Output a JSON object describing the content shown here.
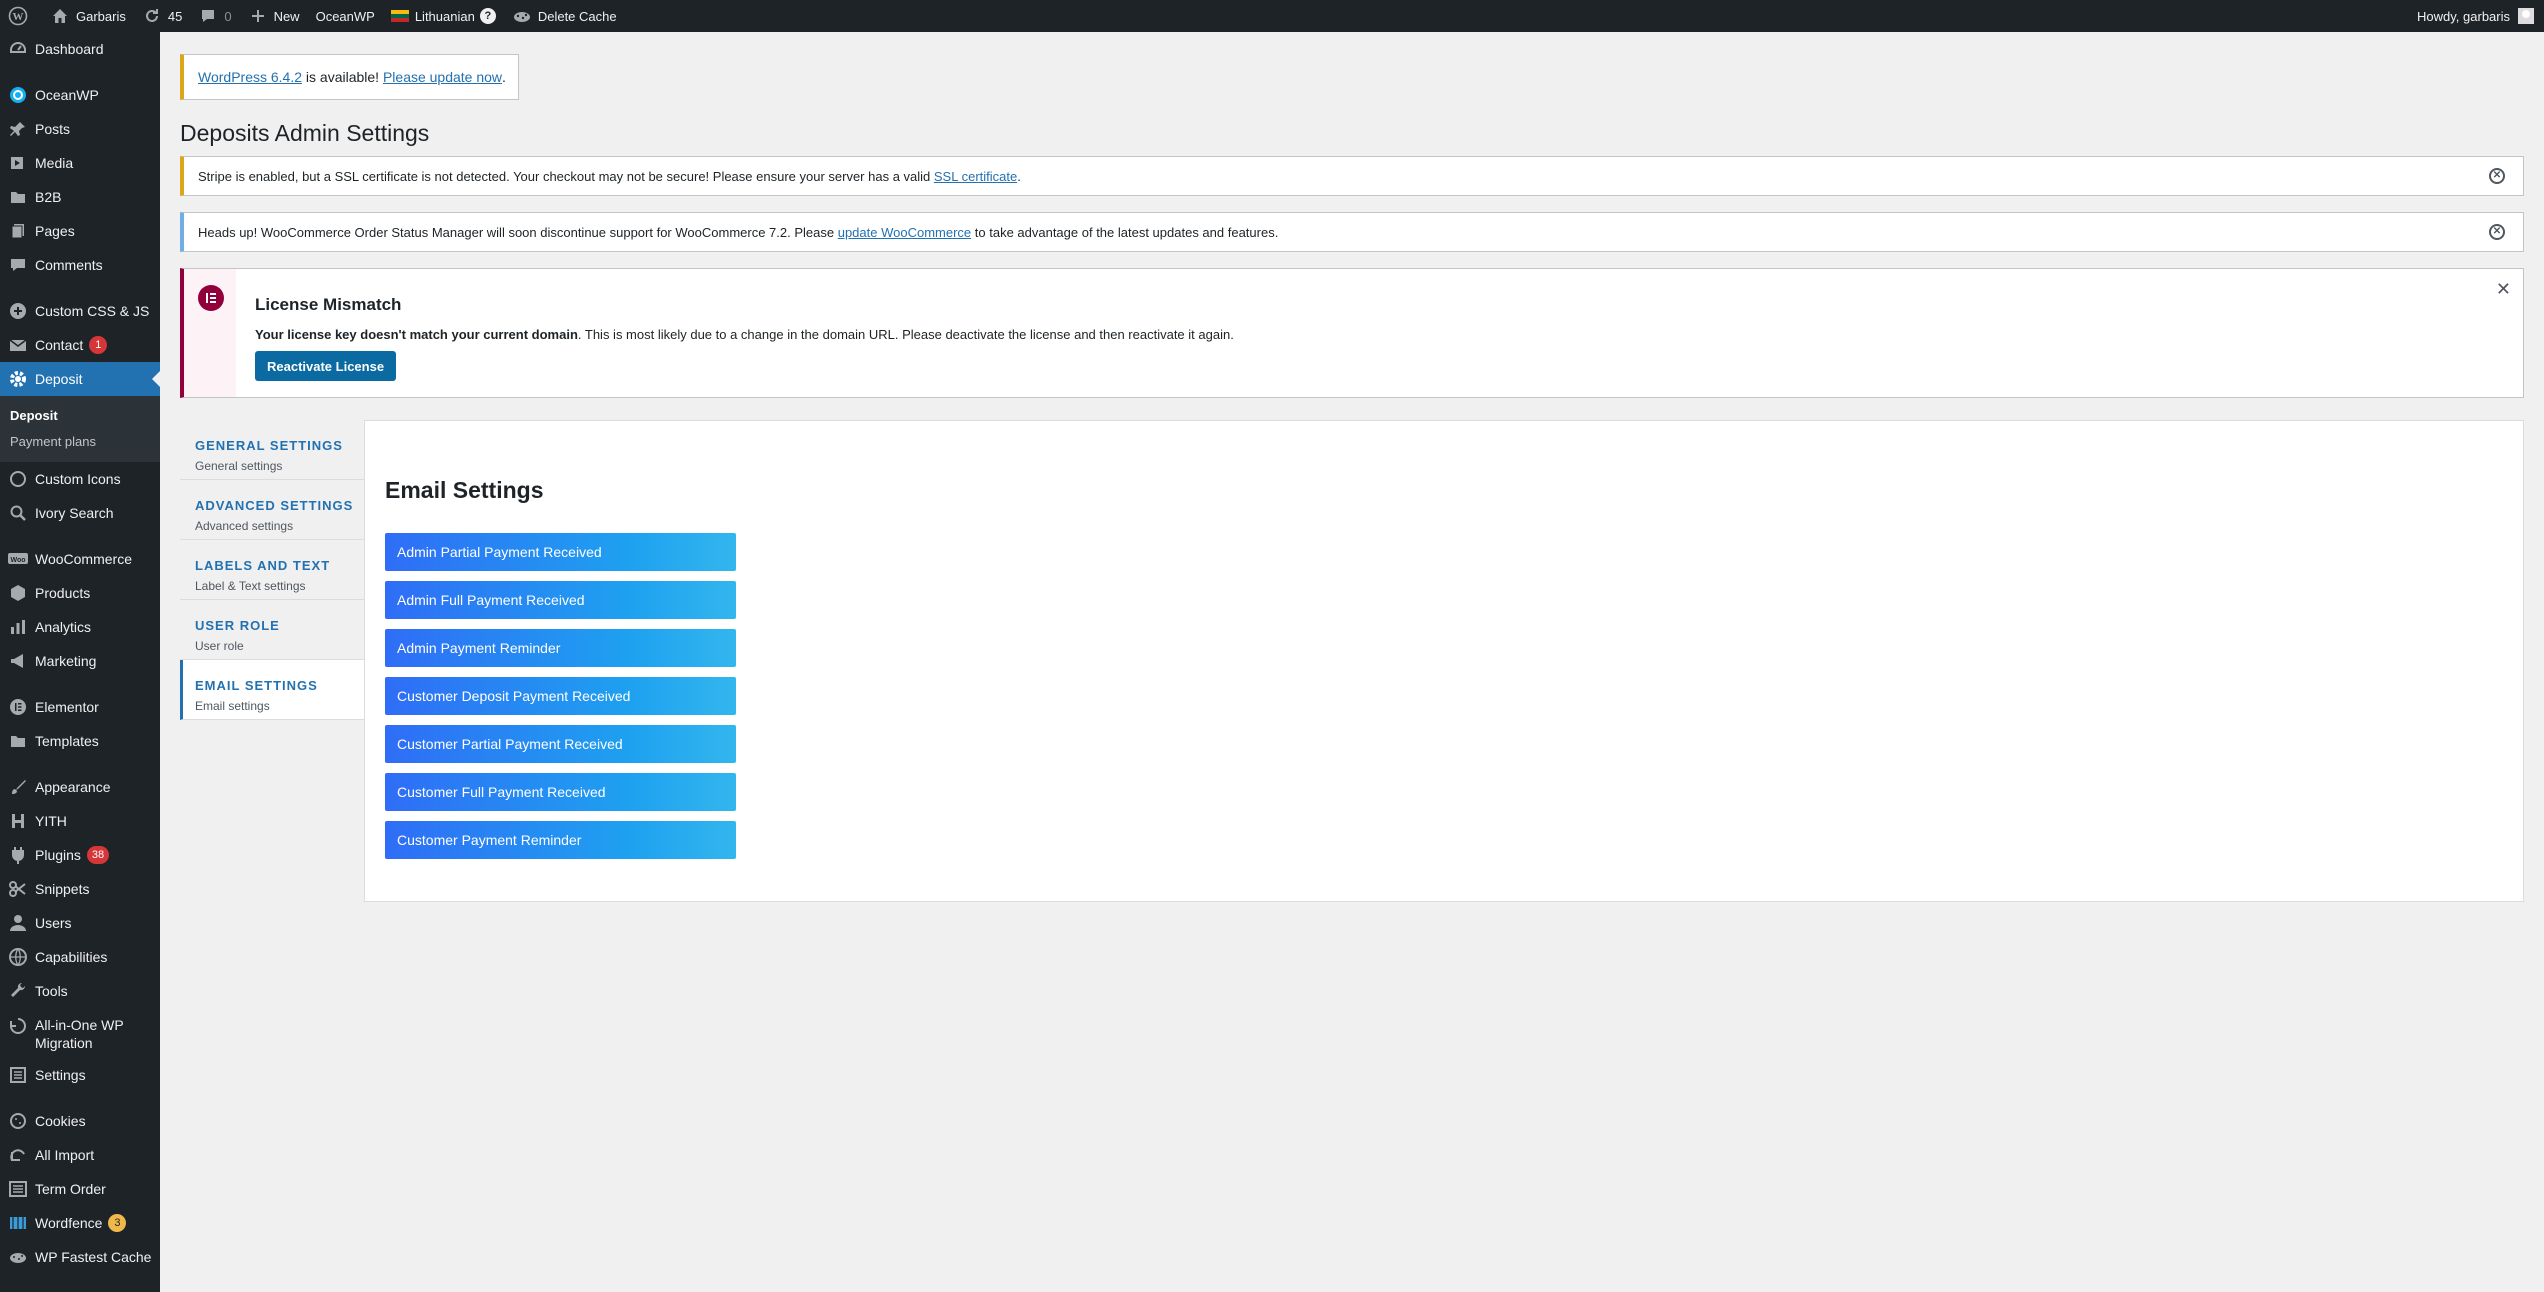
{
  "adminbar": {
    "site_name": "Garbaris",
    "updates_count": "45",
    "comments_count": "0",
    "new_label": "New",
    "theme_label": "OceanWP",
    "language_label": "Lithuanian",
    "language_help": "?",
    "cache_label": "Delete Cache",
    "howdy": "Howdy, garbaris"
  },
  "sidebar": {
    "items": [
      {
        "label": "Dashboard",
        "icon": "dashboard-icon"
      },
      {
        "label": "OceanWP",
        "icon": "oceanwp-icon"
      },
      {
        "label": "Posts",
        "icon": "pin-icon"
      },
      {
        "label": "Media",
        "icon": "media-icon"
      },
      {
        "label": "B2B",
        "icon": "folder-icon"
      },
      {
        "label": "Pages",
        "icon": "pages-icon"
      },
      {
        "label": "Comments",
        "icon": "comment-icon"
      },
      {
        "label": "Custom CSS & JS",
        "icon": "plus-circle-icon"
      },
      {
        "label": "Contact",
        "icon": "mail-icon",
        "badge": "1"
      },
      {
        "label": "Deposit",
        "icon": "gear-icon"
      },
      {
        "label": "Custom Icons",
        "icon": "circle-icon"
      },
      {
        "label": "Ivory Search",
        "icon": "search-icon"
      },
      {
        "label": "WooCommerce",
        "icon": "woo-icon"
      },
      {
        "label": "Products",
        "icon": "box-icon"
      },
      {
        "label": "Analytics",
        "icon": "bar-chart-icon"
      },
      {
        "label": "Marketing",
        "icon": "megaphone-icon"
      },
      {
        "label": "Elementor",
        "icon": "elementor-icon"
      },
      {
        "label": "Templates",
        "icon": "folder-icon"
      },
      {
        "label": "Appearance",
        "icon": "brush-icon"
      },
      {
        "label": "YITH",
        "icon": "yith-icon"
      },
      {
        "label": "Plugins",
        "icon": "plug-icon",
        "badge": "38"
      },
      {
        "label": "Snippets",
        "icon": "scissors-icon"
      },
      {
        "label": "Users",
        "icon": "user-icon"
      },
      {
        "label": "Capabilities",
        "icon": "globe-icon"
      },
      {
        "label": "Tools",
        "icon": "wrench-icon"
      },
      {
        "label": "All-in-One WP Migration",
        "icon": "migration-icon"
      },
      {
        "label": "Settings",
        "icon": "settings-icon"
      },
      {
        "label": "Cookies",
        "icon": "cookie-icon"
      },
      {
        "label": "All Import",
        "icon": "import-icon"
      },
      {
        "label": "Term Order",
        "icon": "list-icon"
      },
      {
        "label": "Wordfence",
        "icon": "wordfence-icon",
        "badge": "3"
      },
      {
        "label": "WP Fastest Cache",
        "icon": "cheetah-icon"
      }
    ],
    "submenu": [
      "Deposit",
      "Payment plans"
    ]
  },
  "notices": {
    "update_version_link": "WordPress 6.4.2",
    "update_middle": " is available! ",
    "update_now_link": "Please update now",
    "update_end": ".",
    "stripe_text": "Stripe is enabled, but a SSL certificate is not detected. Your checkout may not be secure! Please ensure your server has a valid ",
    "stripe_link": "SSL certificate",
    "stripe_end": ".",
    "woo_text": "Heads up! WooCommerce Order Status Manager will soon discontinue support for WooCommerce 7.2. Please ",
    "woo_link": "update WooCommerce",
    "woo_end": " to take advantage of the latest updates and features."
  },
  "page_title": "Deposits Admin Settings",
  "license": {
    "title": "License Mismatch",
    "bold": "Your license key doesn't match your current domain",
    "text": ". This is most likely due to a change in the domain URL. Please deactivate the license and then reactivate it again.",
    "button": "Reactivate License"
  },
  "tabs": [
    {
      "title": "General Settings",
      "sub": "General settings"
    },
    {
      "title": "Advanced Settings",
      "sub": "Advanced settings"
    },
    {
      "title": "Labels and Text",
      "sub": "Label & Text settings"
    },
    {
      "title": "User Role",
      "sub": "User role"
    },
    {
      "title": "Email Settings",
      "sub": "Email settings"
    }
  ],
  "panel": {
    "title": "Email Settings",
    "emails": [
      "Admin Partial Payment Received",
      "Admin Full Payment Received",
      "Admin Payment Reminder",
      "Customer Deposit Payment Received",
      "Customer Partial Payment Received",
      "Customer Full Payment Received",
      "Customer Payment Reminder"
    ]
  },
  "colors": {
    "admin_dark": "#1d2327",
    "accent_blue": "#2271b1",
    "warning": "#dba617",
    "info": "#72aee6",
    "elementor": "#92003b"
  }
}
